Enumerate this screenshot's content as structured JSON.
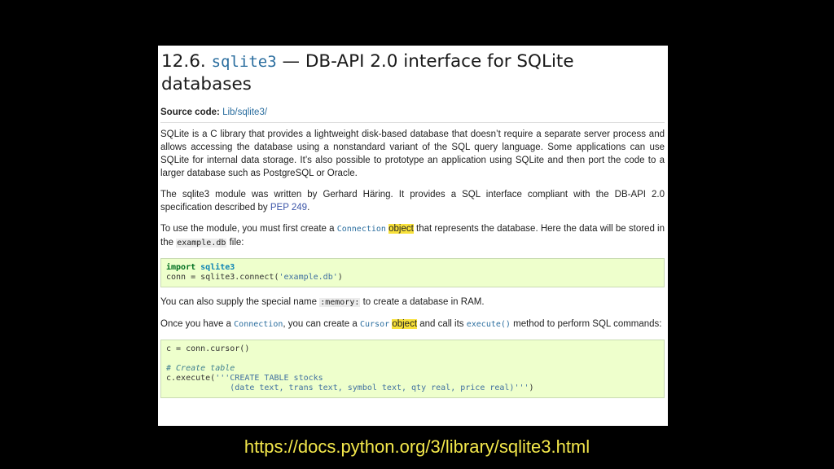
{
  "doc": {
    "title_num": "12.6.",
    "title_mod": "sqlite3",
    "title_rest": "— DB-API 2.0 interface for SQLite databases",
    "source_label": "Source code:",
    "source_link": "Lib/sqlite3/",
    "p1": "SQLite is a C library that provides a lightweight disk-based database that doesn’t require a separate server process and allows accessing the database using a nonstandard variant of the SQL query language. Some applications can use SQLite for internal data storage. It’s also possible to prototype an application using SQLite and then port the code to a larger database such as PostgreSQL or Oracle.",
    "p2_a": "The sqlite3 module was written by Gerhard Häring. It provides a SQL interface compliant with the DB-API 2.0 specification described by ",
    "p2_link": "PEP 249",
    "p2_b": ".",
    "p3_a": "To use the module, you must first create a ",
    "p3_conn": "Connection",
    "p3_obj": "object",
    "p3_b": " that represents the database. Here the data will be stored in the ",
    "p3_file": "example.db",
    "p3_c": " file:",
    "code1_kw": "import",
    "code1_mod": "sqlite3",
    "code1_line2a": "conn = sqlite3.connect(",
    "code1_str": "'example.db'",
    "code1_line2b": ")",
    "p4_a": "You can also supply the special name ",
    "p4_mem": ":memory:",
    "p4_b": " to create a database in RAM.",
    "p5_a": "Once you have a ",
    "p5_conn": "Connection",
    "p5_b": ", you can create a ",
    "p5_cursor": "Cursor",
    "p5_obj": "object",
    "p5_c": " and call its ",
    "p5_exec": "execute()",
    "p5_d": " method to perform SQL commands:",
    "code2_l1": "c = conn.cursor()",
    "code2_comment": "# Create table",
    "code2_l3a": "c.execute(",
    "code2_l3str": "'''CREATE TABLE stocks",
    "code2_l4str": "             (date text, trans text, symbol text, qty real, price real)'''",
    "code2_l4b": ")"
  },
  "caption": "https://docs.python.org/3/library/sqlite3.html"
}
